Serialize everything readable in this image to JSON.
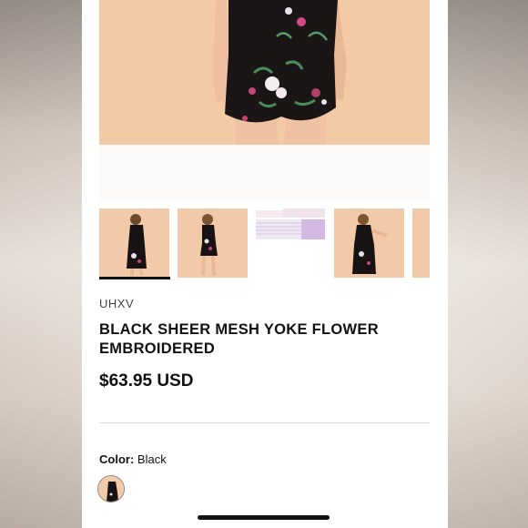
{
  "product": {
    "brand": "UHXV",
    "title": "BLACK SHEER MESH YOKE FLOWER EMBROIDERED",
    "price": "$63.95 USD",
    "color_label": "Color:",
    "color_value": "Black"
  },
  "thumbnails": [
    {
      "name": "thumbnail-back-view",
      "active": true
    },
    {
      "name": "thumbnail-front-view",
      "active": false
    },
    {
      "name": "thumbnail-size-chart",
      "active": false,
      "chart_brand": "SHEIN"
    },
    {
      "name": "thumbnail-side-view",
      "active": false
    },
    {
      "name": "thumbnail-partial",
      "active": false
    }
  ],
  "colors": {
    "accent": "#111111",
    "background": "#ffffff",
    "photo_backdrop": "#f4c9a6",
    "divider": "#dddddd"
  }
}
